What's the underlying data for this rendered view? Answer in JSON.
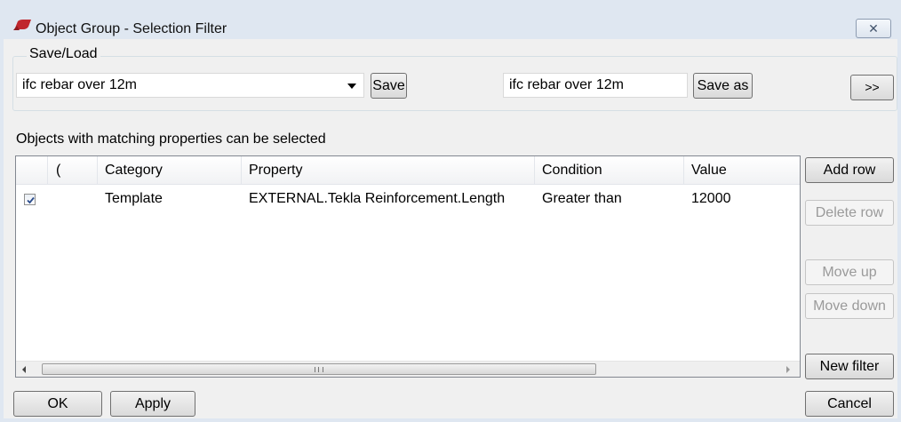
{
  "window": {
    "title": "Object Group - Selection Filter",
    "close_glyph": "✕",
    "app_icon": "tekla-icon",
    "accent_color": "#c0262d"
  },
  "save_load": {
    "group_label": "Save/Load",
    "filter_selected": "ifc rebar over 12m",
    "save_label": "Save",
    "save_as_name": "ifc rebar over 12m",
    "save_as_label": "Save as",
    "expand_label": ">>"
  },
  "info_text": "Objects with matching properties can be selected",
  "grid": {
    "columns": [
      "(",
      "Category",
      "Property",
      "Condition",
      "Value"
    ],
    "rows": [
      {
        "checked": true,
        "paren": "",
        "category": "Template",
        "property": "EXTERNAL.Tekla Reinforcement.Length",
        "condition": "Greater than",
        "value": "12000"
      }
    ],
    "scroll_grip": "III"
  },
  "side_buttons": {
    "add_row": "Add row",
    "delete_row": "Delete row",
    "move_up": "Move up",
    "move_down": "Move down",
    "new_filter": "New filter"
  },
  "footer": {
    "ok": "OK",
    "apply": "Apply",
    "cancel": "Cancel"
  }
}
